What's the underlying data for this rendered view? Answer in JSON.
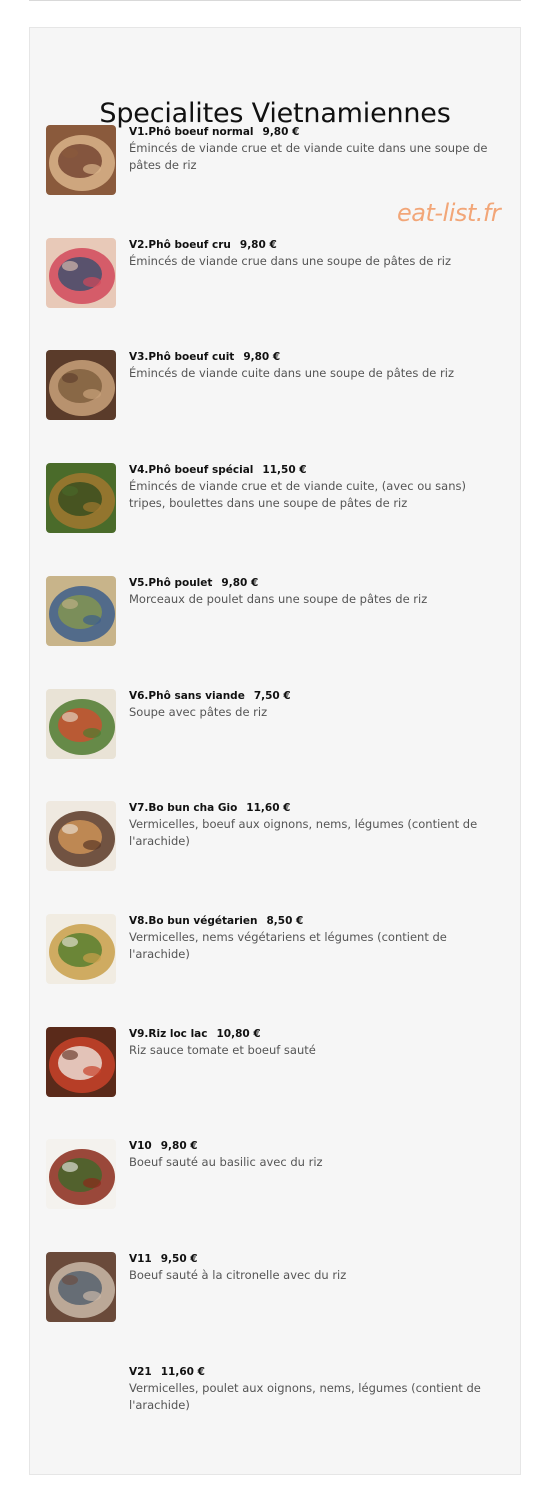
{
  "page": {
    "title": "Specialites Vietnamiennes",
    "watermark": "eat-list.fr"
  },
  "items": [
    {
      "name": "V1.Phô boeuf normal",
      "price": "9,80 €",
      "description": "Émincés de viande crue et de viande cuite dans une soupe de pâtes de riz",
      "image": "pho-beef-photo",
      "colors": [
        "#8a5a3c",
        "#d9b48a",
        "#6b3a2a"
      ]
    },
    {
      "name": "V2.Phô boeuf cru",
      "price": "9,80 €",
      "description": "Émincés de viande crue dans une soupe de pâtes de riz",
      "image": "pho-raw-beef-photo",
      "colors": [
        "#e8c9b8",
        "#d1495b",
        "#2f4f6f"
      ]
    },
    {
      "name": "V3.Phô boeuf cuit",
      "price": "9,80 €",
      "description": "Émincés de viande cuite dans une soupe de pâtes de riz",
      "image": "pho-cooked-beef-photo",
      "colors": [
        "#5a3b2a",
        "#c9a27a",
        "#7a5a3a"
      ]
    },
    {
      "name": "V4.Phô boeuf spécial",
      "price": "11,50 €",
      "description": "Émincés de viande crue et de viande cuite, (avec ou sans) tripes, boulettes dans une soupe de pâtes de riz",
      "image": "pho-special-photo",
      "colors": [
        "#4a6b2a",
        "#a0772f",
        "#2e4a1e"
      ]
    },
    {
      "name": "V5.Phô poulet",
      "price": "9,80 €",
      "description": "Morceaux de poulet dans une soupe de pâtes de riz",
      "image": "pho-chicken-photo",
      "colors": [
        "#c8b48a",
        "#3d5e8a",
        "#8a9a4a"
      ]
    },
    {
      "name": "V6.Phô sans viande",
      "price": "7,50 €",
      "description": "Soupe avec pâtes de riz",
      "image": "pho-vegetarian-photo",
      "colors": [
        "#e9e3d6",
        "#4f7a2f",
        "#d64a2e"
      ]
    },
    {
      "name": "V7.Bo bun cha Gio",
      "price": "11,60 €",
      "description": "Vermicelles, boeuf aux oignons, nems, légumes (contient de l'arachide)",
      "image": "bo-bun-photo",
      "colors": [
        "#efe9e0",
        "#5a3826",
        "#d89a5a"
      ]
    },
    {
      "name": "V8.Bo bun végétarien",
      "price": "8,50 €",
      "description": "Vermicelles, nems végétariens et légumes (contient de l'arachide)",
      "image": "bo-bun-vegetarian-photo",
      "colors": [
        "#f1ece2",
        "#c9a04a",
        "#4a7a2a"
      ]
    },
    {
      "name": "V9.Riz loc lac",
      "price": "10,80 €",
      "description": "Riz sauce tomate et boeuf sauté",
      "image": "riz-loc-lac-photo",
      "colors": [
        "#5a2a1a",
        "#c8422a",
        "#f2f0ea"
      ]
    },
    {
      "name": "V10",
      "price": "9,80 €",
      "description": "Boeuf sauté au basilic avec du riz",
      "image": "beef-basil-photo",
      "colors": [
        "#f4f2ee",
        "#8a2a1a",
        "#3a6a2a"
      ]
    },
    {
      "name": "V11",
      "price": "9,50 €",
      "description": "Boeuf sauté à la citronelle avec du riz",
      "image": "beef-lemongrass-photo",
      "colors": [
        "#6a4a3a",
        "#c9b8a8",
        "#4a5a6a"
      ]
    },
    {
      "name": "V21",
      "price": "11,60 €",
      "description": "Vermicelles, poulet aux oignons, nems, légumes (contient de l'arachide)",
      "image": "",
      "colors": []
    }
  ]
}
